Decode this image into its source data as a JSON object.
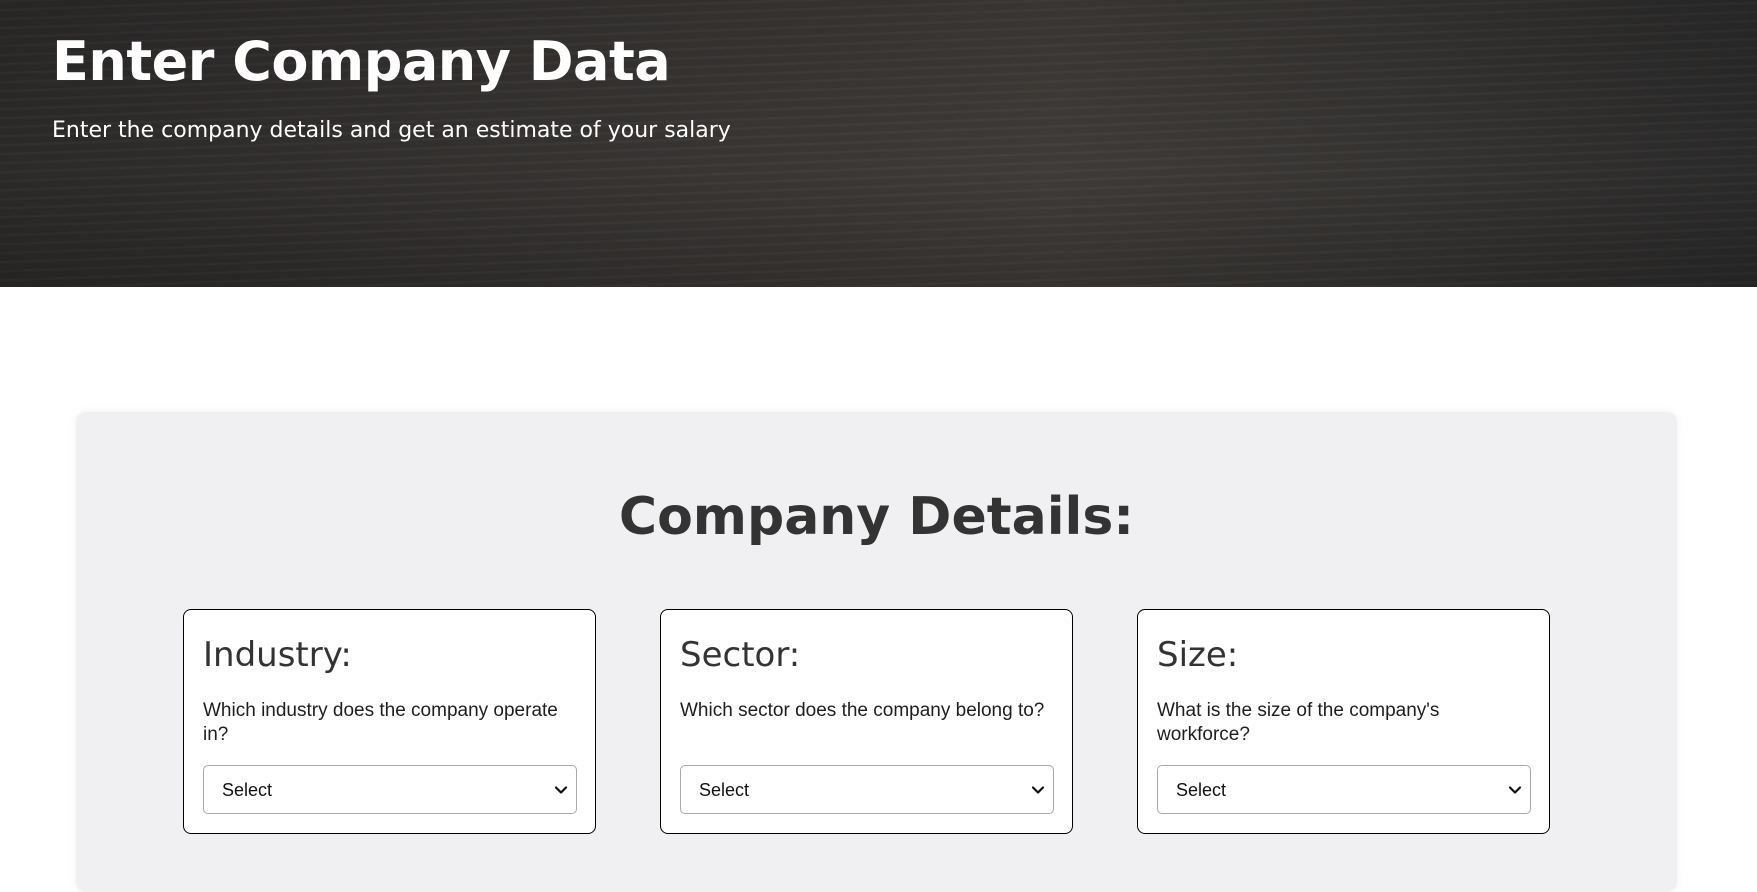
{
  "hero": {
    "title": "Enter Company Data",
    "subtitle": "Enter the company details and get an estimate of your salary"
  },
  "details": {
    "title": "Company Details:",
    "cards": [
      {
        "heading": "Industry:",
        "question": "Which industry does the company operate in?",
        "select_value": "Select"
      },
      {
        "heading": "Sector:",
        "question": "Which sector does the company belong to?",
        "select_value": "Select"
      },
      {
        "heading": "Size:",
        "question": "What is the size of the company's workforce?",
        "select_value": "Select"
      }
    ]
  },
  "icons": {
    "dropdown": "chevron-down-icon"
  },
  "colors": {
    "panel_background": "#f0f0f2",
    "card_border": "#000000",
    "heading_text": "#333333"
  }
}
